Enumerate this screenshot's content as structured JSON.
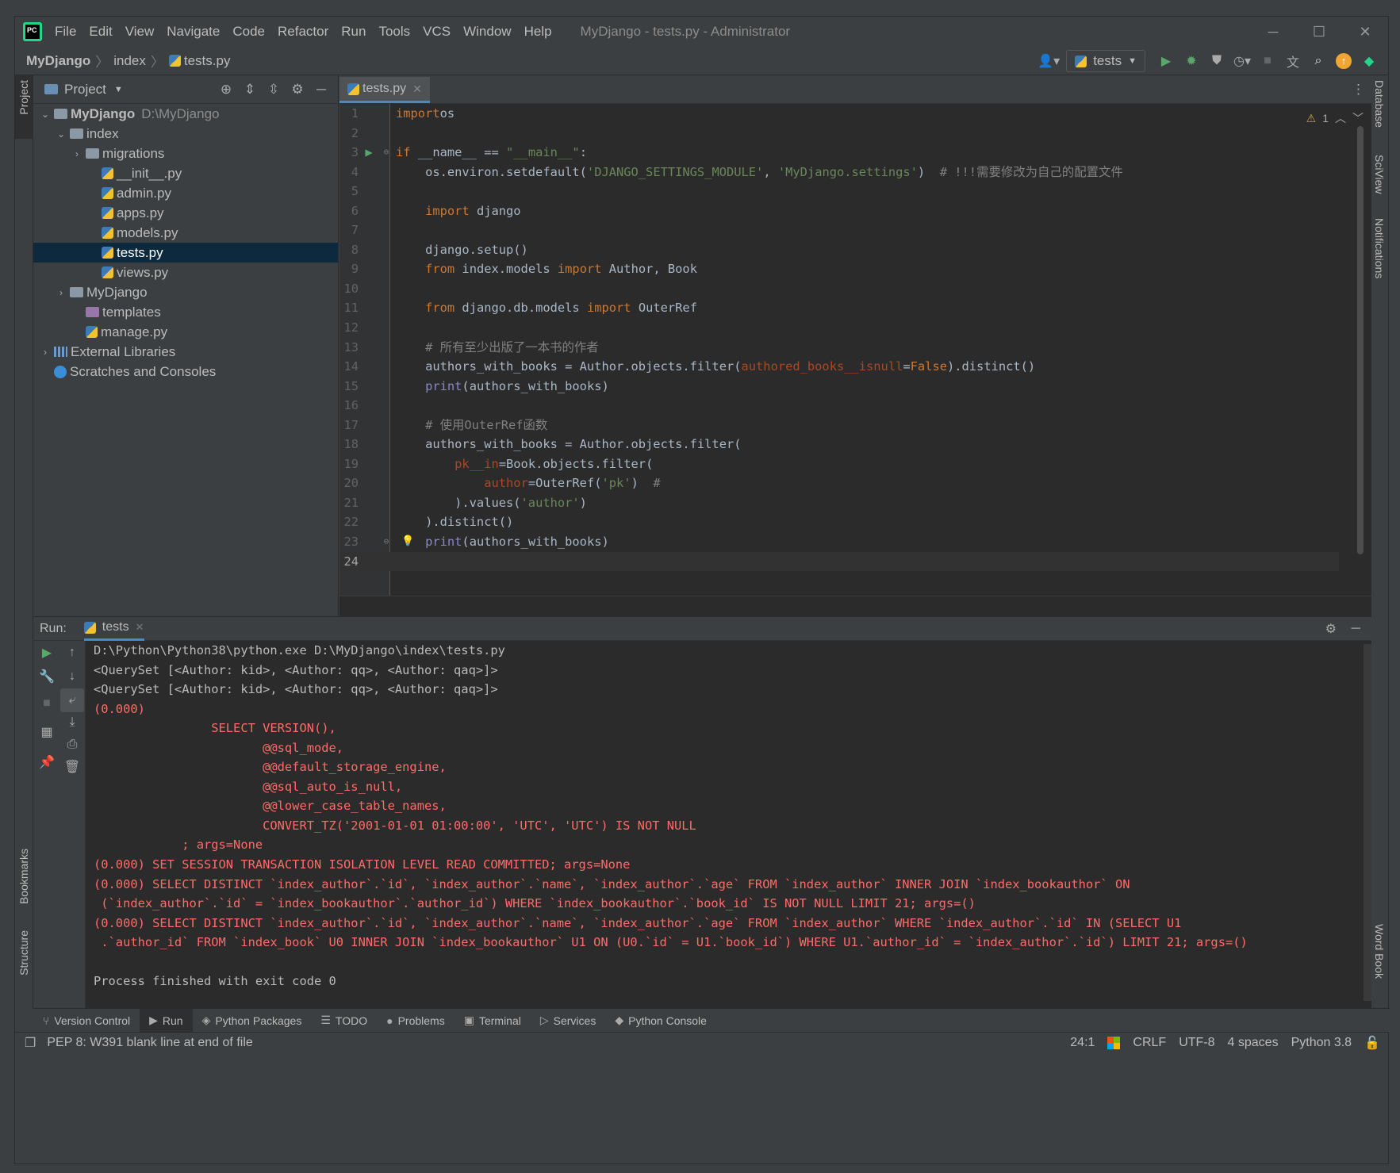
{
  "menu": [
    "File",
    "Edit",
    "View",
    "Navigate",
    "Code",
    "Refactor",
    "Run",
    "Tools",
    "VCS",
    "Window",
    "Help"
  ],
  "window_title": "MyDjango - tests.py - Administrator",
  "breadcrumb": [
    "MyDjango",
    "index",
    "tests.py"
  ],
  "run_config": "tests",
  "left_stripe": {
    "project": "Project",
    "bookmarks": "Bookmarks",
    "structure": "Structure"
  },
  "right_stripe": {
    "database": "Database",
    "sciview": "SciView",
    "notifications": "Notifications",
    "wordbook": "Word Book"
  },
  "project_panel": {
    "title": "Project",
    "tree": [
      {
        "label": "MyDjango",
        "extra": "D:\\MyDjango",
        "level": 0,
        "type": "folder",
        "expanded": true,
        "bold": true
      },
      {
        "label": "index",
        "level": 1,
        "type": "folder",
        "expanded": true
      },
      {
        "label": "migrations",
        "level": 2,
        "type": "folder",
        "expanded": false
      },
      {
        "label": "__init__.py",
        "level": 3,
        "type": "py"
      },
      {
        "label": "admin.py",
        "level": 3,
        "type": "py"
      },
      {
        "label": "apps.py",
        "level": 3,
        "type": "py"
      },
      {
        "label": "models.py",
        "level": 3,
        "type": "py"
      },
      {
        "label": "tests.py",
        "level": 3,
        "type": "py",
        "selected": true
      },
      {
        "label": "views.py",
        "level": 3,
        "type": "py"
      },
      {
        "label": "MyDjango",
        "level": 1,
        "type": "folder",
        "expanded": false
      },
      {
        "label": "templates",
        "level": 2,
        "type": "purple"
      },
      {
        "label": "manage.py",
        "level": 2,
        "type": "py"
      },
      {
        "label": "External Libraries",
        "level": 0,
        "type": "lib",
        "expanded": false
      },
      {
        "label": "Scratches and Consoles",
        "level": 0,
        "type": "scratch"
      }
    ]
  },
  "editor": {
    "tab": "tests.py",
    "warnings": "1",
    "current_line": 24,
    "lines": [
      [
        [
          "kw",
          "import"
        ],
        [
          "",
          "os"
        ]
      ],
      [],
      [
        [
          "kw",
          "if"
        ],
        [
          "",
          " __name__ == "
        ],
        [
          "st",
          "\"__main__\""
        ],
        [
          "",
          ":"
        ]
      ],
      [
        [
          "",
          "    os.environ.setdefault("
        ],
        [
          "st",
          "'DJANGO_SETTINGS_MODULE'"
        ],
        [
          "",
          ", "
        ],
        [
          "st",
          "'MyDjango.settings'"
        ],
        [
          "",
          ")  "
        ],
        [
          "cm",
          "# !!!需要修改为自己的配置文件"
        ]
      ],
      [],
      [
        [
          "",
          "    "
        ],
        [
          "kw",
          "import"
        ],
        [
          "",
          " django"
        ]
      ],
      [],
      [
        [
          "",
          "    django.setup()"
        ]
      ],
      [
        [
          "",
          "    "
        ],
        [
          "kw",
          "from"
        ],
        [
          "",
          " index.models "
        ],
        [
          "kw",
          "import"
        ],
        [
          "",
          " Author, Book"
        ]
      ],
      [],
      [
        [
          "",
          "    "
        ],
        [
          "kw",
          "from"
        ],
        [
          "",
          " django.db.models "
        ],
        [
          "kw",
          "import"
        ],
        [
          "",
          " OuterRef"
        ]
      ],
      [],
      [
        [
          "",
          "    "
        ],
        [
          "cm",
          "# 所有至少出版了一本书的作者"
        ]
      ],
      [
        [
          "",
          "    authors_with_books = Author.objects.filter("
        ],
        [
          "pa",
          "authored_books__isnull"
        ],
        [
          "",
          "="
        ],
        [
          "kw",
          "False"
        ],
        [
          "",
          ").distinct()"
        ]
      ],
      [
        [
          "",
          "    "
        ],
        [
          "bi",
          "print"
        ],
        [
          "",
          "(authors_with_books)"
        ]
      ],
      [],
      [
        [
          "",
          "    "
        ],
        [
          "cm",
          "# 使用OuterRef函数"
        ]
      ],
      [
        [
          "",
          "    authors_with_books = Author.objects.filter("
        ]
      ],
      [
        [
          "",
          "        "
        ],
        [
          "pa",
          "pk__in"
        ],
        [
          "",
          "=Book.objects.filter("
        ]
      ],
      [
        [
          "",
          "            "
        ],
        [
          "pa",
          "author"
        ],
        [
          "",
          "=OuterRef("
        ],
        [
          "st",
          "'pk'"
        ],
        [
          "",
          ")  "
        ],
        [
          "cm",
          "#"
        ]
      ],
      [
        [
          "",
          "        ).values("
        ],
        [
          "st",
          "'author'"
        ],
        [
          "",
          ")"
        ]
      ],
      [
        [
          "",
          "    ).distinct()"
        ]
      ],
      [
        [
          "",
          "    "
        ],
        [
          "bi",
          "print"
        ],
        [
          "",
          "(authors_with_books)"
        ]
      ],
      []
    ]
  },
  "run_panel": {
    "label": "Run:",
    "tab": "tests",
    "output": [
      {
        "t": "D:\\Python\\Python38\\python.exe D:\\MyDjango\\index\\tests.py",
        "e": false
      },
      {
        "t": "<QuerySet [<Author: kid>, <Author: qq>, <Author: qaq>]>",
        "e": false
      },
      {
        "t": "<QuerySet [<Author: kid>, <Author: qq>, <Author: qaq>]>",
        "e": false
      },
      {
        "t": "(0.000)",
        "e": true
      },
      {
        "t": "                SELECT VERSION(),",
        "e": true
      },
      {
        "t": "                       @@sql_mode,",
        "e": true
      },
      {
        "t": "                       @@default_storage_engine,",
        "e": true
      },
      {
        "t": "                       @@sql_auto_is_null,",
        "e": true
      },
      {
        "t": "                       @@lower_case_table_names,",
        "e": true
      },
      {
        "t": "                       CONVERT_TZ('2001-01-01 01:00:00', 'UTC', 'UTC') IS NOT NULL",
        "e": true
      },
      {
        "t": "            ; args=None",
        "e": true
      },
      {
        "t": "(0.000) SET SESSION TRANSACTION ISOLATION LEVEL READ COMMITTED; args=None",
        "e": true
      },
      {
        "t": "(0.000) SELECT DISTINCT `index_author`.`id`, `index_author`.`name`, `index_author`.`age` FROM `index_author` INNER JOIN `index_bookauthor` ON",
        "e": true
      },
      {
        "t": " (`index_author`.`id` = `index_bookauthor`.`author_id`) WHERE `index_bookauthor`.`book_id` IS NOT NULL LIMIT 21; args=()",
        "e": true
      },
      {
        "t": "(0.000) SELECT DISTINCT `index_author`.`id`, `index_author`.`name`, `index_author`.`age` FROM `index_author` WHERE `index_author`.`id` IN (SELECT U1",
        "e": true
      },
      {
        "t": " .`author_id` FROM `index_book` U0 INNER JOIN `index_bookauthor` U1 ON (U0.`id` = U1.`book_id`) WHERE U1.`author_id` = `index_author`.`id`) LIMIT 21; args=()",
        "e": true
      },
      {
        "t": "",
        "e": false
      },
      {
        "t": "Process finished with exit code 0",
        "e": false
      }
    ]
  },
  "tool_windows": [
    "Version Control",
    "Run",
    "Python Packages",
    "TODO",
    "Problems",
    "Terminal",
    "Services",
    "Python Console"
  ],
  "status": {
    "message": "PEP 8: W391 blank line at end of file",
    "position": "24:1",
    "line_sep": "CRLF",
    "encoding": "UTF-8",
    "indent": "4 spaces",
    "interpreter": "Python 3.8"
  }
}
